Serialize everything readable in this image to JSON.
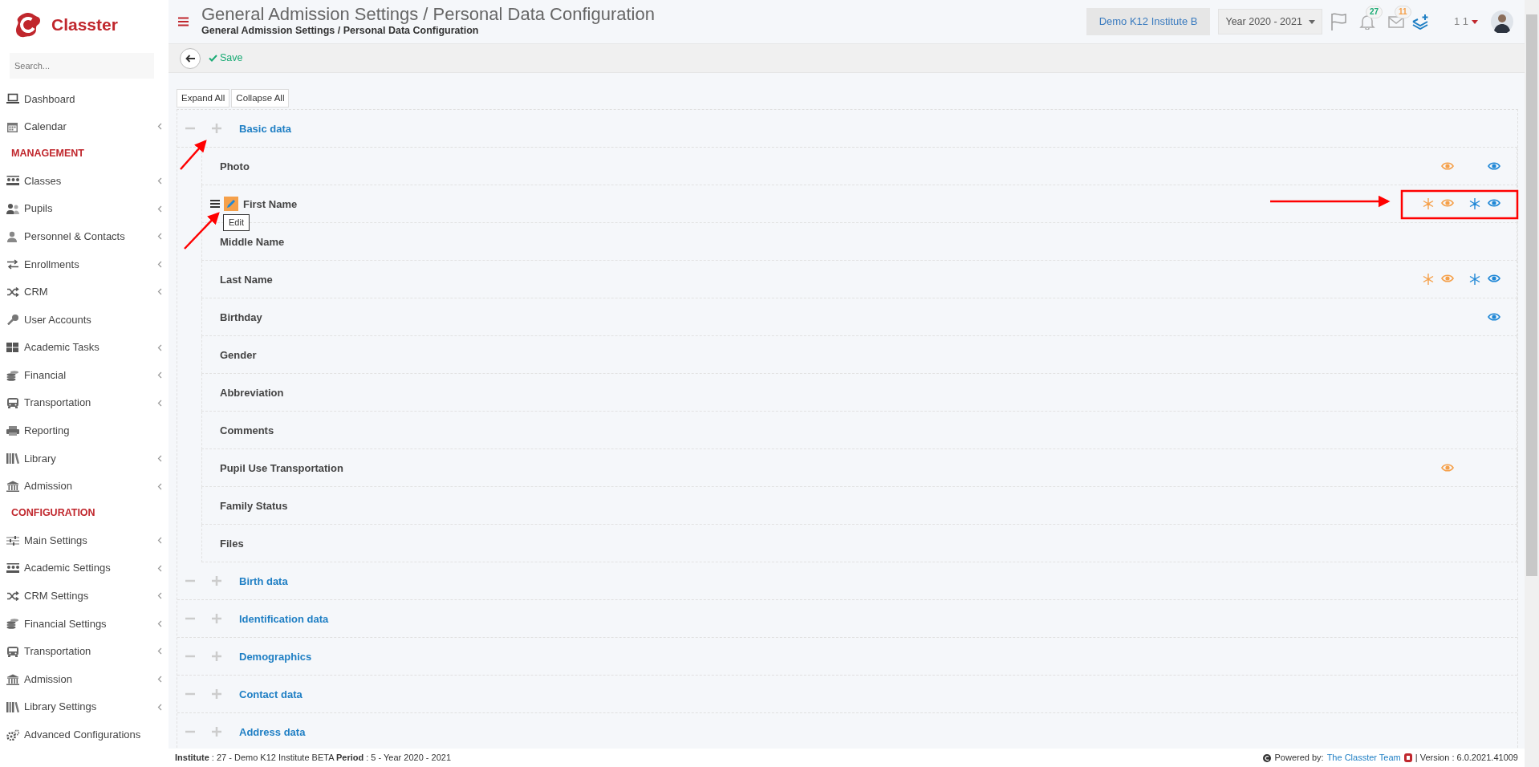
{
  "sidebar": {
    "logo": "Classter",
    "search": {
      "placeholder": "Search..."
    },
    "items": [
      {
        "kind": "item",
        "label": "Dashboard",
        "submenu": false
      },
      {
        "kind": "item",
        "label": "Calendar",
        "submenu": true
      },
      {
        "kind": "heading",
        "label": "MANAGEMENT"
      },
      {
        "kind": "item",
        "label": "Classes",
        "submenu": true
      },
      {
        "kind": "item",
        "label": "Pupils",
        "submenu": true
      },
      {
        "kind": "item",
        "label": "Personnel & Contacts",
        "submenu": true
      },
      {
        "kind": "item",
        "label": "Enrollments",
        "submenu": true
      },
      {
        "kind": "item",
        "label": "CRM",
        "submenu": true
      },
      {
        "kind": "item",
        "label": "User Accounts",
        "submenu": false
      },
      {
        "kind": "item",
        "label": "Academic Tasks",
        "submenu": true
      },
      {
        "kind": "item",
        "label": "Financial",
        "submenu": true
      },
      {
        "kind": "item",
        "label": "Transportation",
        "submenu": true
      },
      {
        "kind": "item",
        "label": "Reporting",
        "submenu": false
      },
      {
        "kind": "item",
        "label": "Library",
        "submenu": true
      },
      {
        "kind": "item",
        "label": "Admission",
        "submenu": true
      },
      {
        "kind": "heading",
        "label": "CONFIGURATION"
      },
      {
        "kind": "item",
        "label": "Main Settings",
        "submenu": true
      },
      {
        "kind": "item",
        "label": "Academic Settings",
        "submenu": true
      },
      {
        "kind": "item",
        "label": "CRM Settings",
        "submenu": true
      },
      {
        "kind": "item",
        "label": "Financial Settings",
        "submenu": true
      },
      {
        "kind": "item",
        "label": "Transportation",
        "submenu": true
      },
      {
        "kind": "item",
        "label": "Admission",
        "submenu": true
      },
      {
        "kind": "item",
        "label": "Library Settings",
        "submenu": true
      },
      {
        "kind": "item",
        "label": "Advanced Configurations",
        "submenu": false
      }
    ]
  },
  "header": {
    "title": "General Admission Settings / Personal Data Configuration",
    "subtitle": "General Admission Settings / Personal Data Configuration",
    "institute": "Demo K12 Institute B",
    "year": "Year 2020 - 2021",
    "notifications": "27",
    "messages": "11",
    "user": "1 1"
  },
  "toolbar": {
    "save": "Save"
  },
  "tree_buttons": [
    "Expand All",
    "Collapse All"
  ],
  "sections": [
    {
      "title": "Basic data",
      "fields": [
        {
          "label": "Photo",
          "hovered": false,
          "orange_required": false,
          "orange_visible": true,
          "blue_required": false,
          "blue_visible": true
        },
        {
          "label": "First Name",
          "hovered": true,
          "tooltip": "Edit",
          "orange_required": true,
          "orange_visible": true,
          "blue_required": true,
          "blue_visible": true
        },
        {
          "label": "Middle Name",
          "hovered": false,
          "orange_required": false,
          "orange_visible": false,
          "blue_required": false,
          "blue_visible": false
        },
        {
          "label": "Last Name",
          "hovered": false,
          "orange_required": true,
          "orange_visible": true,
          "blue_required": true,
          "blue_visible": true
        },
        {
          "label": "Birthday",
          "hovered": false,
          "orange_required": false,
          "orange_visible": false,
          "blue_required": false,
          "blue_visible": true
        },
        {
          "label": "Gender",
          "hovered": false,
          "orange_required": false,
          "orange_visible": false,
          "blue_required": false,
          "blue_visible": false
        },
        {
          "label": "Abbreviation",
          "hovered": false,
          "orange_required": false,
          "orange_visible": false,
          "blue_required": false,
          "blue_visible": false
        },
        {
          "label": "Comments",
          "hovered": false,
          "orange_required": false,
          "orange_visible": false,
          "blue_required": false,
          "blue_visible": false
        },
        {
          "label": "Pupil Use Transportation",
          "hovered": false,
          "orange_required": false,
          "orange_visible": true,
          "blue_required": false,
          "blue_visible": false
        },
        {
          "label": "Family Status",
          "hovered": false,
          "orange_required": false,
          "orange_visible": false,
          "blue_required": false,
          "blue_visible": false
        },
        {
          "label": "Files",
          "hovered": false,
          "orange_required": false,
          "orange_visible": false,
          "blue_required": false,
          "blue_visible": false
        }
      ]
    },
    {
      "title": "Birth data"
    },
    {
      "title": "Identification data"
    },
    {
      "title": "Demographics"
    },
    {
      "title": "Contact data"
    },
    {
      "title": "Address data"
    }
  ],
  "footer": {
    "info": "**Institute** : 27 - Demo K12 Institute BETA **Period** : 5 - Year 2020 - 2021",
    "powered": "Powered by:",
    "team": "The Classter Team",
    "version": "| Version : 6.0.2021.41009"
  }
}
